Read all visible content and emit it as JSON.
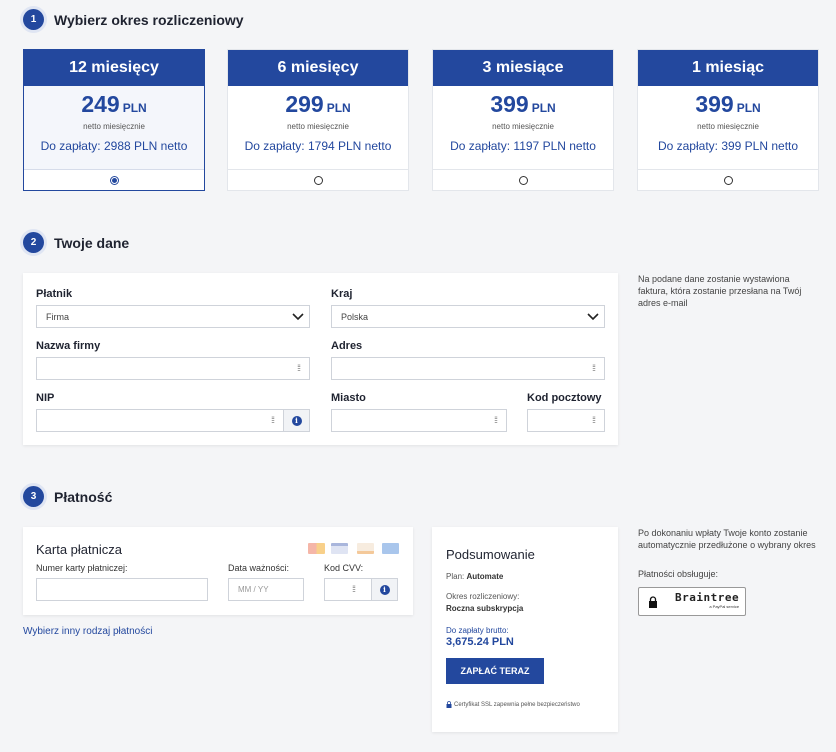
{
  "steps": [
    {
      "num": "1",
      "title": "Wybierz okres rozliczeniowy"
    },
    {
      "num": "2",
      "title": "Twoje dane"
    },
    {
      "num": "3",
      "title": "Płatność"
    }
  ],
  "plans": [
    {
      "title": "12 miesięcy",
      "price": "249",
      "currency": "PLN",
      "netto": "netto miesięcznie",
      "pay": "Do zapłaty: 2988 PLN netto",
      "selected": true
    },
    {
      "title": "6 miesięcy",
      "price": "299",
      "currency": "PLN",
      "netto": "netto miesięcznie",
      "pay": "Do zapłaty: 1794 PLN netto",
      "selected": false
    },
    {
      "title": "3 miesiące",
      "price": "399",
      "currency": "PLN",
      "netto": "netto miesięcznie",
      "pay": "Do zapłaty: 1197 PLN netto",
      "selected": false
    },
    {
      "title": "1 miesiąc",
      "price": "399",
      "currency": "PLN",
      "netto": "netto miesięcznie",
      "pay": "Do zapłaty: 399 PLN netto",
      "selected": false
    }
  ],
  "form": {
    "platnik_label": "Płatnik",
    "platnik_value": "Firma",
    "kraj_label": "Kraj",
    "kraj_value": "Polska",
    "nazwa_label": "Nazwa firmy",
    "adres_label": "Adres",
    "nip_label": "NIP",
    "miasto_label": "Miasto",
    "kod_label": "Kod pocztowy",
    "note": "Na podane dane zostanie wystawiona faktura, która zostanie przesłana na Twój adres e-mail"
  },
  "payment": {
    "card_title": "Karta płatnicza",
    "card_number_label": "Numer karty płatniczej:",
    "expiry_label": "Data ważności:",
    "expiry_placeholder": "MM / YY",
    "cvv_label": "Kod CVV:",
    "other_method_link": "Wybierz inny rodzaj płatności",
    "card_icons": [
      "mastercard-icon",
      "visa-icon",
      "discover-icon",
      "amex-icon"
    ]
  },
  "summary": {
    "title": "Podsumowanie",
    "plan_label": "Plan:",
    "plan_value": "Automate",
    "period_label": "Okres rozliczeniowy:",
    "period_value": "Roczna subskrypcja",
    "due_label": "Do zapłaty brutto:",
    "due_value": "3,675.24 PLN",
    "pay_button": "ZAPŁAĆ TERAZ",
    "ssl_note": "Certyfikat SSL zapewnia pełne bezpieczeństwo"
  },
  "side": {
    "renew_note": "Po dokonaniu wpłaty Twoje konto zostanie automatycznie przedłużone o wybrany okres",
    "payments_label": "Płatności obsługuje:",
    "braintree": "Braintree",
    "braintree_sub": "a PayPal service"
  },
  "colors": {
    "accent": "#23489e",
    "background": "#f4f5f7"
  }
}
